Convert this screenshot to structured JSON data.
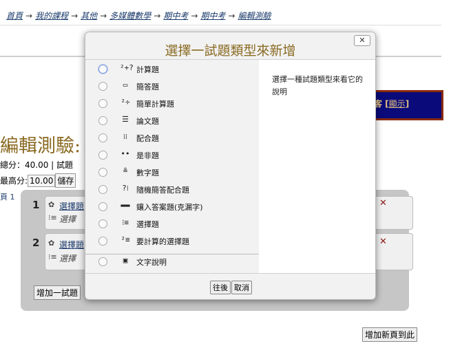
{
  "breadcrumb": [
    "首頁",
    "我的課程",
    "其他",
    "多媒體數學",
    "期中考",
    "期中考",
    "編輯測驗"
  ],
  "background": {
    "title": "編輯測驗: ",
    "total_label": "總分：40.00 | 試題",
    "max_label": "最高分:",
    "max_value": "10.00",
    "save_label": "儲存",
    "page_label": "頁 1",
    "show_prefix": "客 [",
    "show_link": "顯示",
    "show_suffix": "]",
    "questions": [
      {
        "num": "1",
        "link": "選擇題",
        "sub": "選擇"
      },
      {
        "num": "2",
        "link": "選擇題",
        "sub": "選擇"
      }
    ],
    "add_question_label": "增加一試題",
    "add_page_label": "增加新頁到此"
  },
  "dialog": {
    "title": "選擇一試題類型來新增",
    "close_label": "✕",
    "description": "選擇一種試題類型來看它的說明",
    "types": [
      {
        "icon": "calculated-icon",
        "glyph": "²+?",
        "label": "計算題"
      },
      {
        "icon": "shortanswer-icon",
        "glyph": "▭",
        "label": "簡答題"
      },
      {
        "icon": "calculatedsimple-icon",
        "glyph": "²÷",
        "label": "簡單計算題"
      },
      {
        "icon": "essay-icon",
        "glyph": "☰",
        "label": "論文題"
      },
      {
        "icon": "match-icon",
        "glyph": "⁞⁞",
        "label": "配合題"
      },
      {
        "icon": "truefalse-icon",
        "glyph": "••",
        "label": "是非題"
      },
      {
        "icon": "numerical-icon",
        "glyph": "≗",
        "label": "數字題"
      },
      {
        "icon": "randomsamatch-icon",
        "glyph": "?⁞",
        "label": "隨機簡答配合題"
      },
      {
        "icon": "multianswer-icon",
        "glyph": "▬▬",
        "label": "鑲入答案題(克漏字)"
      },
      {
        "icon": "multichoice-icon",
        "glyph": "⁝≡",
        "label": "選擇題"
      },
      {
        "icon": "calculatedmulti-icon",
        "glyph": "²≡",
        "label": "要計算的選擇題"
      }
    ],
    "other": {
      "icon": "description-icon",
      "glyph": "▣",
      "label": "文字說明"
    },
    "next_label": "往後",
    "cancel_label": "取消"
  }
}
